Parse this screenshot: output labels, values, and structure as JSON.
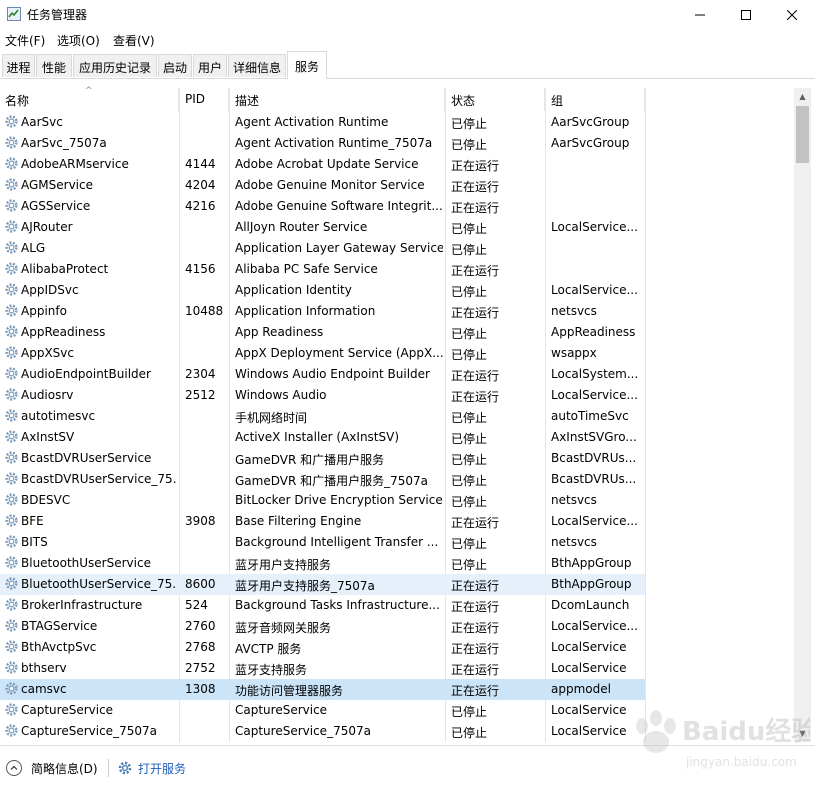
{
  "window": {
    "title": "任务管理器",
    "controls": {
      "minimize": "—",
      "maximize": "☐",
      "close": "✕"
    }
  },
  "menu": [
    "文件(F)",
    "选项(O)",
    "查看(V)"
  ],
  "tabs": [
    "进程",
    "性能",
    "应用历史记录",
    "启动",
    "用户",
    "详细信息",
    "服务"
  ],
  "active_tab": "服务",
  "columns": [
    "名称",
    "PID",
    "描述",
    "状态",
    "组"
  ],
  "sort_indicator": "^",
  "rows": [
    {
      "name": "AarSvc",
      "pid": "",
      "desc": "Agent Activation Runtime",
      "status": "已停止",
      "group": "AarSvcGroup"
    },
    {
      "name": "AarSvc_7507a",
      "pid": "",
      "desc": "Agent Activation Runtime_7507a",
      "status": "已停止",
      "group": "AarSvcGroup"
    },
    {
      "name": "AdobeARMservice",
      "pid": "4144",
      "desc": "Adobe Acrobat Update Service",
      "status": "正在运行",
      "group": ""
    },
    {
      "name": "AGMService",
      "pid": "4204",
      "desc": "Adobe Genuine Monitor Service",
      "status": "正在运行",
      "group": ""
    },
    {
      "name": "AGSService",
      "pid": "4216",
      "desc": "Adobe Genuine Software Integrit...",
      "status": "正在运行",
      "group": ""
    },
    {
      "name": "AJRouter",
      "pid": "",
      "desc": "AllJoyn Router Service",
      "status": "已停止",
      "group": "LocalService..."
    },
    {
      "name": "ALG",
      "pid": "",
      "desc": "Application Layer Gateway Service",
      "status": "已停止",
      "group": ""
    },
    {
      "name": "AlibabaProtect",
      "pid": "4156",
      "desc": "Alibaba PC Safe Service",
      "status": "正在运行",
      "group": ""
    },
    {
      "name": "AppIDSvc",
      "pid": "",
      "desc": "Application Identity",
      "status": "已停止",
      "group": "LocalService..."
    },
    {
      "name": "Appinfo",
      "pid": "10488",
      "desc": "Application Information",
      "status": "正在运行",
      "group": "netsvcs"
    },
    {
      "name": "AppReadiness",
      "pid": "",
      "desc": "App Readiness",
      "status": "已停止",
      "group": "AppReadiness"
    },
    {
      "name": "AppXSvc",
      "pid": "",
      "desc": "AppX Deployment Service (AppX...",
      "status": "已停止",
      "group": "wsappx"
    },
    {
      "name": "AudioEndpointBuilder",
      "pid": "2304",
      "desc": "Windows Audio Endpoint Builder",
      "status": "正在运行",
      "group": "LocalSystem..."
    },
    {
      "name": "Audiosrv",
      "pid": "2512",
      "desc": "Windows Audio",
      "status": "正在运行",
      "group": "LocalService..."
    },
    {
      "name": "autotimesvc",
      "pid": "",
      "desc": "手机网络时间",
      "status": "已停止",
      "group": "autoTimeSvc"
    },
    {
      "name": "AxInstSV",
      "pid": "",
      "desc": "ActiveX Installer (AxInstSV)",
      "status": "已停止",
      "group": "AxInstSVGro..."
    },
    {
      "name": "BcastDVRUserService",
      "pid": "",
      "desc": "GameDVR 和广播用户服务",
      "status": "已停止",
      "group": "BcastDVRUs..."
    },
    {
      "name": "BcastDVRUserService_75...",
      "pid": "",
      "desc": "GameDVR 和广播用户服务_7507a",
      "status": "已停止",
      "group": "BcastDVRUs..."
    },
    {
      "name": "BDESVC",
      "pid": "",
      "desc": "BitLocker Drive Encryption Service",
      "status": "已停止",
      "group": "netsvcs"
    },
    {
      "name": "BFE",
      "pid": "3908",
      "desc": "Base Filtering Engine",
      "status": "正在运行",
      "group": "LocalService..."
    },
    {
      "name": "BITS",
      "pid": "",
      "desc": "Background Intelligent Transfer ...",
      "status": "已停止",
      "group": "netsvcs"
    },
    {
      "name": "BluetoothUserService",
      "pid": "",
      "desc": "蓝牙用户支持服务",
      "status": "已停止",
      "group": "BthAppGroup"
    },
    {
      "name": "BluetoothUserService_75...",
      "pid": "8600",
      "desc": "蓝牙用户支持服务_7507a",
      "status": "正在运行",
      "group": "BthAppGroup"
    },
    {
      "name": "BrokerInfrastructure",
      "pid": "524",
      "desc": "Background Tasks Infrastructure...",
      "status": "正在运行",
      "group": "DcomLaunch"
    },
    {
      "name": "BTAGService",
      "pid": "2760",
      "desc": "蓝牙音频网关服务",
      "status": "正在运行",
      "group": "LocalService..."
    },
    {
      "name": "BthAvctpSvc",
      "pid": "2768",
      "desc": "AVCTP 服务",
      "status": "正在运行",
      "group": "LocalService"
    },
    {
      "name": "bthserv",
      "pid": "2752",
      "desc": "蓝牙支持服务",
      "status": "正在运行",
      "group": "LocalService"
    },
    {
      "name": "camsvc",
      "pid": "1308",
      "desc": "功能访问管理器服务",
      "status": "正在运行",
      "group": "appmodel"
    },
    {
      "name": "CaptureService",
      "pid": "",
      "desc": "CaptureService",
      "status": "已停止",
      "group": "LocalService"
    },
    {
      "name": "CaptureService_7507a",
      "pid": "",
      "desc": "CaptureService_7507a",
      "status": "已停止",
      "group": "LocalService"
    }
  ],
  "hover_row": "BluetoothUserService_75...",
  "selected_row": "camsvc",
  "footer": {
    "fewer_details": "简略信息(D)",
    "open_services": "打开服务"
  },
  "watermark": "Baidu经验 jingyan.baidu.com",
  "colors": {
    "hover_row": "#e6f0fb",
    "selected_row": "#cce4f7",
    "link": "#1f5fbf"
  }
}
